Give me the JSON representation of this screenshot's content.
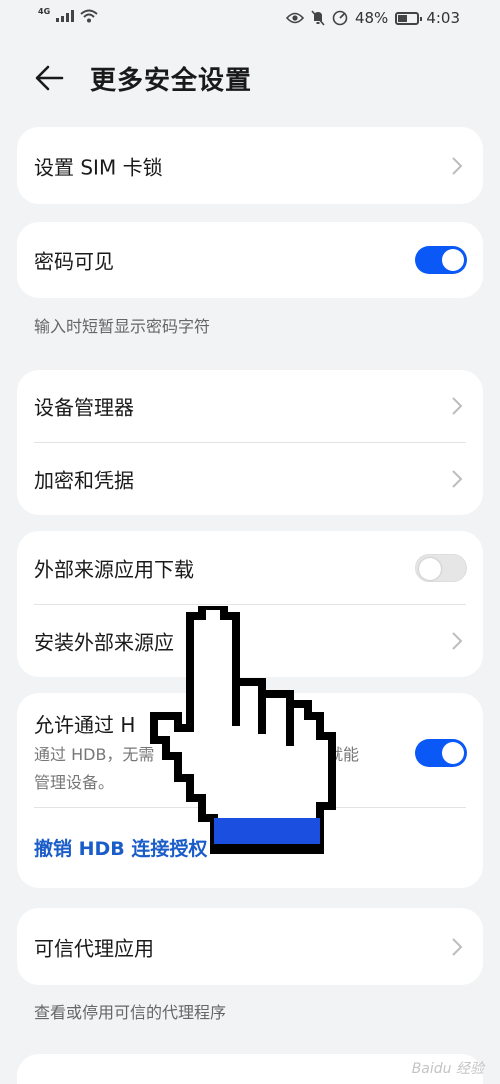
{
  "status_bar": {
    "network": "4G",
    "battery_percent": "48%",
    "battery_level": 0.48,
    "time": "4:03"
  },
  "header": {
    "title": "更多安全设置"
  },
  "sections": {
    "sim_lock": {
      "label": "设置 SIM 卡锁"
    },
    "password_visible": {
      "label": "密码可见",
      "enabled": true,
      "hint": "输入时短暂显示密码字符"
    },
    "device_admin": {
      "label": "设备管理器"
    },
    "encryption": {
      "label": "加密和凭据"
    },
    "external_download": {
      "label": "外部来源应用下载",
      "enabled": false
    },
    "install_external": {
      "label": "安装外部来源应"
    },
    "hdb": {
      "label": "允许通过 H",
      "desc_line1": "通过 HDB，无需",
      "desc_line1_end": "就能",
      "desc_line2": "管理设备。",
      "enabled": true,
      "revoke_label": "撤销 HDB 连接授权"
    },
    "trust_agent": {
      "label": "可信代理应用",
      "hint": "查看或停用可信的代理程序"
    }
  },
  "watermark": "Baidu 经验",
  "colors": {
    "accent": "#0a59f7",
    "link": "#1a5cc8",
    "background": "#f1f3f5",
    "card": "#ffffff"
  }
}
